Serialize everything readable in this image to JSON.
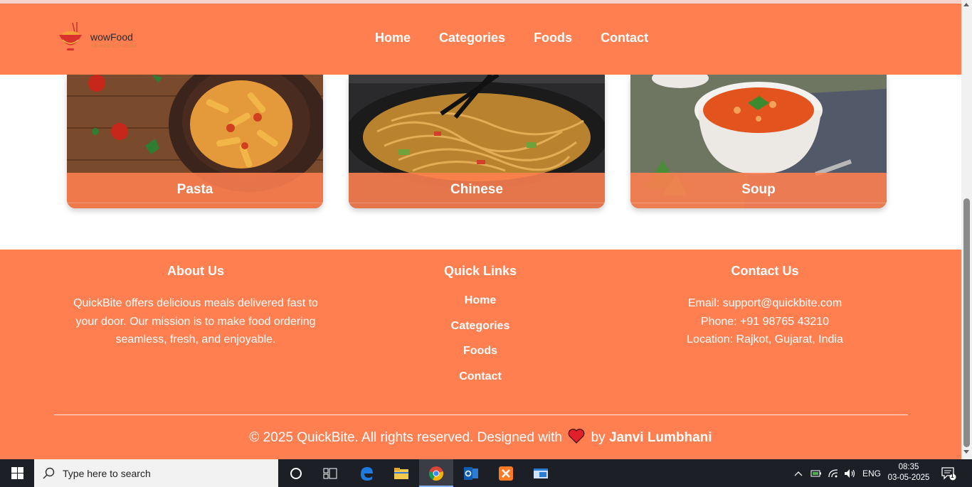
{
  "header": {
    "brand": "wowFood",
    "tagline": "THE FOOD RESTAURANT",
    "nav": [
      "Home",
      "Categories",
      "Foods",
      "Contact"
    ]
  },
  "categories": [
    {
      "label": "Pasta"
    },
    {
      "label": "Chinese"
    },
    {
      "label": "Soup"
    }
  ],
  "footer": {
    "about": {
      "title": "About Us",
      "text": "QuickBite offers delicious meals delivered fast to your door. Our mission is to make food ordering seamless, fresh, and enjoyable."
    },
    "quick_links": {
      "title": "Quick Links",
      "items": [
        "Home",
        "Categories",
        "Foods",
        "Contact"
      ]
    },
    "contact": {
      "title": "Contact Us",
      "email": "Email: support@quickbite.com",
      "phone": "Phone: +91 98765 43210",
      "location": "Location: Rajkot, Gujarat, India"
    },
    "copyright_pre": "© 2025 QuickBite. All rights reserved. Designed with",
    "copyright_by": "by",
    "author": "Janvi Lumbhani"
  },
  "taskbar": {
    "search_placeholder": "Type here to search",
    "language": "ENG",
    "time": "08:35",
    "date": "03-05-2025",
    "notification_count": "1"
  },
  "colors": {
    "accent": "#ff7f50",
    "taskbar": "#1c1f26"
  }
}
